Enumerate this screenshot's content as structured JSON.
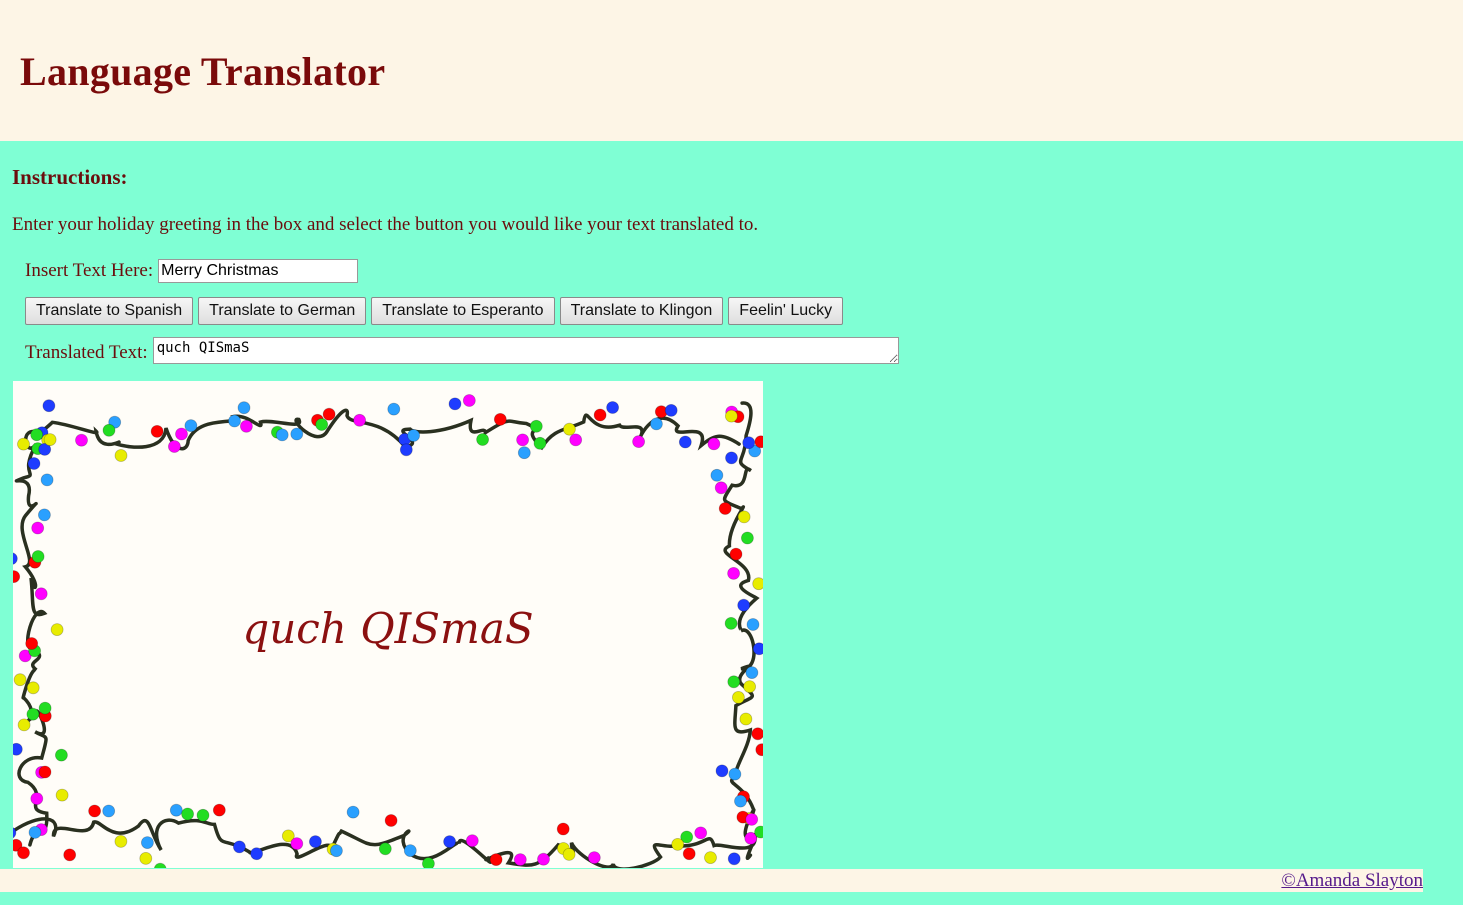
{
  "header": {
    "title": "Language Translator"
  },
  "instructions": {
    "title": "Instructions:",
    "text": "Enter your holiday greeting in the box and select the button you would like your text translated to."
  },
  "input": {
    "label": "Insert Text Here:",
    "value": "Merry Christmas"
  },
  "buttons": {
    "spanish": "Translate to Spanish",
    "german": "Translate to German",
    "esperanto": "Translate to Esperanto",
    "klingon": "Translate to Klingon",
    "lucky": "Feelin' Lucky"
  },
  "output": {
    "label": "Translated Text:",
    "value": "quch QISmaS"
  },
  "card": {
    "greeting": "quch QISmaS",
    "colors": {
      "text": "#8b1010",
      "wire": "#2a3020",
      "bulbs": [
        "#ff0000",
        "#1e3cff",
        "#2aa0ff",
        "#ff00ff",
        "#e8ec00",
        "#22dd22"
      ]
    }
  },
  "footer": {
    "credit": "©Amanda Slayton"
  },
  "colors": {
    "page_bg": "#7fffd4",
    "header_bg": "#fdf5e6",
    "heading": "#7a0a0a",
    "link": "#551a8b"
  }
}
